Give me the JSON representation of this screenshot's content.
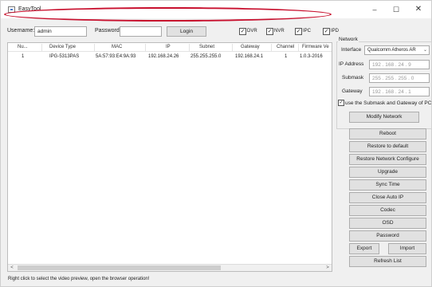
{
  "window": {
    "title": "EasyTool",
    "minimize_glyph": "–",
    "maximize_glyph": "☐",
    "close_glyph": "✕"
  },
  "login": {
    "username_label": "Username:",
    "username_value": "admin",
    "password_label": "Password:",
    "password_value": "",
    "login_button": "Login",
    "filters": [
      {
        "label": "DVR",
        "checked": true
      },
      {
        "label": "NVR",
        "checked": true
      },
      {
        "label": "IPC",
        "checked": true
      },
      {
        "label": "IPD",
        "checked": true
      }
    ]
  },
  "table": {
    "columns": [
      "Nu...",
      "Device Type",
      "MAC",
      "IP",
      "Subnet",
      "Gateway",
      "Channel",
      "Firmware Ve"
    ],
    "rows": [
      {
        "num": "1",
        "type": "IPG-5313PAS",
        "mac": "5A:57:93:E4:9A:93",
        "ip": "192.168.24.26",
        "subnet": "255.255.255.0",
        "gateway": "192.168.24.1",
        "channel": "1",
        "firmware": "1.0.3-2016"
      }
    ],
    "highlight_color": "#c8102e"
  },
  "status_text": "Right click to select the video preview, open the browser operation!",
  "network": {
    "group_title": "Network",
    "interface_label": "Interface",
    "interface_value": "Qualcomm Atheros AR",
    "ip_label": "IP Address",
    "ip_value": "192 . 168 . 24 . 9",
    "submask_label": "Submask",
    "submask_value": "255 . 255 . 255 . 0",
    "gateway_label": "Gateway",
    "gateway_value": "192 . 168 . 24 . 1",
    "use_pc_label": "use the Submask and Gateway of PC",
    "use_pc_checked": true,
    "modify_button": "Modify Network"
  },
  "actions": {
    "reboot": "Reboot",
    "restore_default": "Restore to default",
    "restore_network": "Restore Network Configure",
    "upgrade": "Upgrade",
    "sync_time": "Sync Time",
    "close_auto_ip": "Close Auto IP",
    "codec": "Codec",
    "osd": "OSD",
    "password": "Password",
    "export": "Export",
    "import": "Import",
    "refresh": "Refresh List"
  }
}
